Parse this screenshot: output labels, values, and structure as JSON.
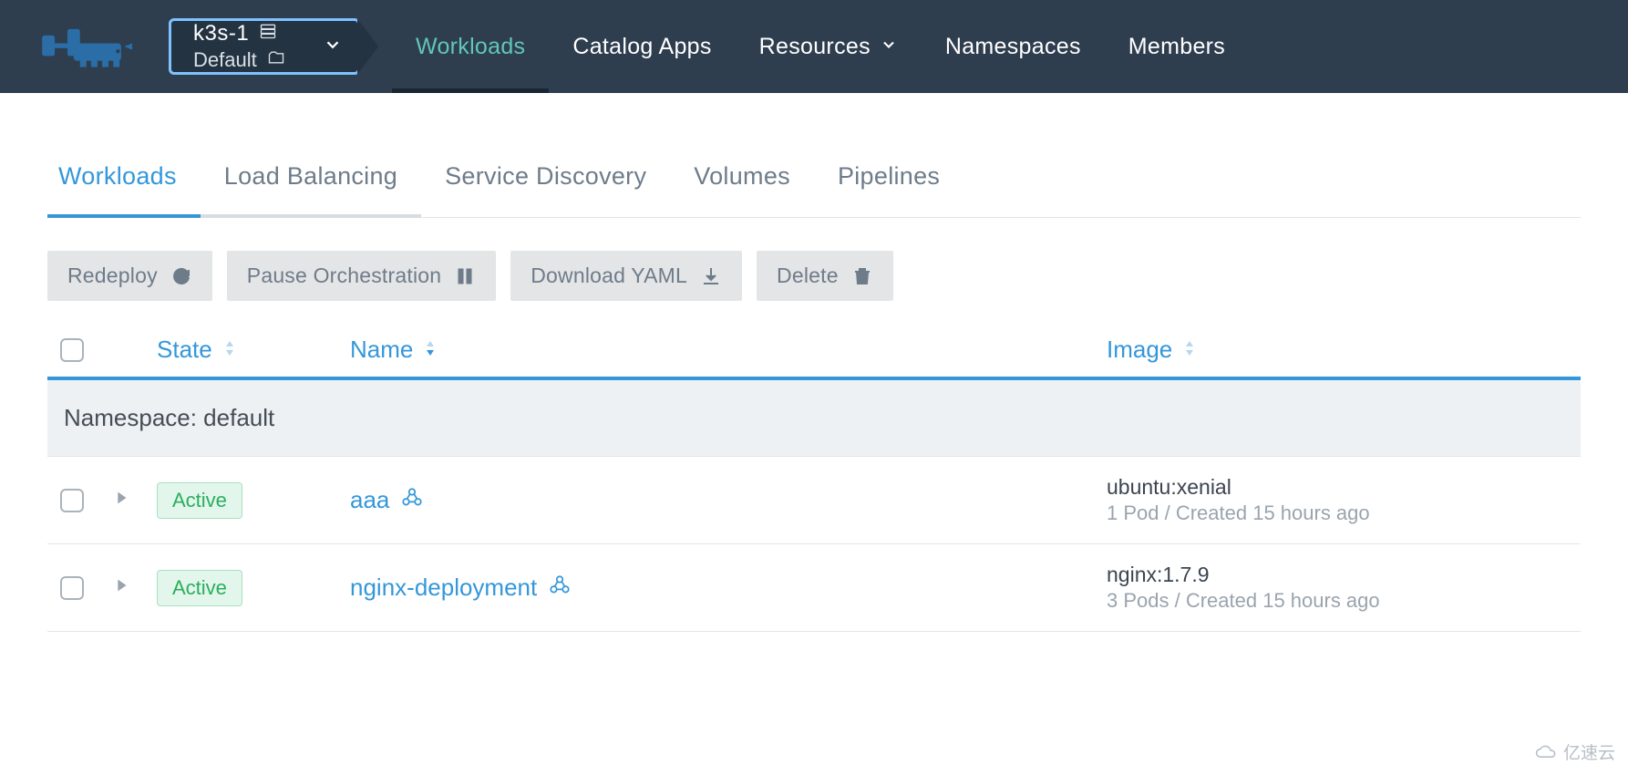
{
  "header": {
    "cluster_name": "k3s-1",
    "project_name": "Default",
    "nav": [
      {
        "label": "Workloads",
        "active": true,
        "has_caret": false
      },
      {
        "label": "Catalog Apps",
        "active": false,
        "has_caret": false
      },
      {
        "label": "Resources",
        "active": false,
        "has_caret": true
      },
      {
        "label": "Namespaces",
        "active": false,
        "has_caret": false
      },
      {
        "label": "Members",
        "active": false,
        "has_caret": false
      }
    ]
  },
  "tabs": [
    {
      "label": "Workloads",
      "state": "active"
    },
    {
      "label": "Load Balancing",
      "state": "secondary-active"
    },
    {
      "label": "Service Discovery",
      "state": ""
    },
    {
      "label": "Volumes",
      "state": ""
    },
    {
      "label": "Pipelines",
      "state": ""
    }
  ],
  "actions": {
    "redeploy": "Redeploy",
    "pause": "Pause Orchestration",
    "download": "Download YAML",
    "delete": "Delete"
  },
  "columns": {
    "state": "State",
    "name": "Name",
    "image": "Image"
  },
  "namespace_label": "Namespace: default",
  "rows": [
    {
      "state": "Active",
      "name": "aaa",
      "image": "ubuntu:xenial",
      "meta": "1 Pod / Created 15 hours ago"
    },
    {
      "state": "Active",
      "name": "nginx-deployment",
      "image": "nginx:1.7.9",
      "meta": "3 Pods / Created 15 hours ago"
    }
  ],
  "watermark": "亿速云"
}
